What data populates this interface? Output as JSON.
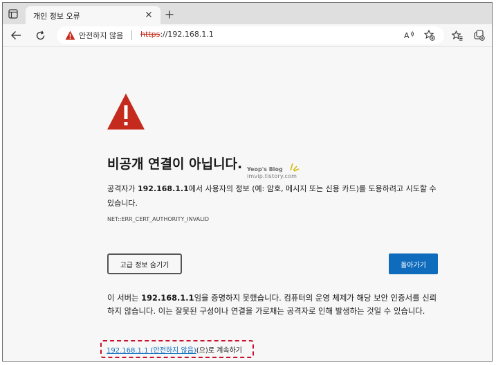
{
  "tab": {
    "title": "개인 정보 오류"
  },
  "address": {
    "not_secure_label": "안전하지 않음",
    "url_scheme": "https",
    "url_rest": "://192.168.1.1"
  },
  "error_page": {
    "heading": "비공개 연결이 아닙니다.",
    "desc_prefix": "공격자가 ",
    "desc_host": "192.168.1.1",
    "desc_suffix": "에서 사용자의 정보 (예: 암호, 메시지 또는 신용 카드)를 도용하려고 시도할 수 있습니다.",
    "error_code": "NET::ERR_CERT_AUTHORITY_INVALID",
    "advanced_button": "고급 정보 숨기기",
    "back_button": "돌아가기",
    "detail_prefix": "이 서버는 ",
    "detail_host": "192.168.1.1",
    "detail_suffix": "임을 증명하지 못했습니다. 컴퓨터의 운영 체제가 해당 보안 인증서를 신뢰하지 않습니다. 이는 잘못된 구성이나 연결을 가로채는 공격자로 인해 발생하는 것일 수 있습니다.",
    "proceed_link": "192.168.1.1 (안전하지 않음)",
    "proceed_suffix": "(으)로 계속하기"
  },
  "watermark": {
    "line1": "Yeop's Blog",
    "line2": "imvip.tistory.com"
  },
  "colors": {
    "danger": "#c42b1c",
    "accent": "#0f6cbd",
    "highlight": "#c8102e"
  },
  "icons": [
    "tab-actions-icon",
    "close-icon",
    "plus-icon",
    "back-arrow-icon",
    "refresh-icon",
    "warning-icon",
    "read-aloud-icon",
    "add-favorite-icon",
    "favorites-icon",
    "collections-icon"
  ]
}
